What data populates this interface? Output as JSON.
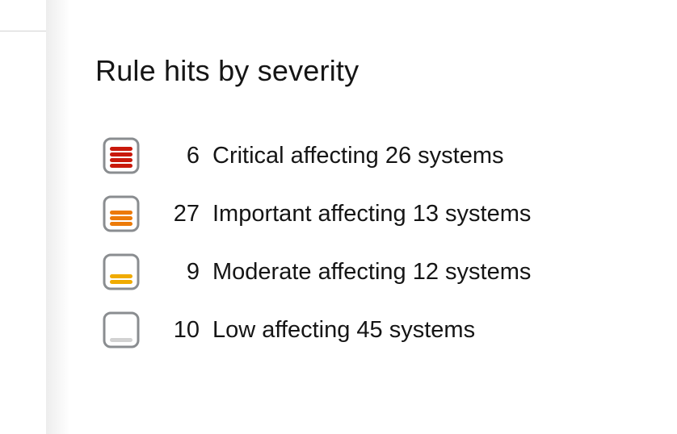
{
  "card": {
    "title": "Rule hits by severity"
  },
  "severity": {
    "items": [
      {
        "icon": "critical-severity-icon",
        "count": "6",
        "label": "Critical affecting 26 systems",
        "bars": 4,
        "color": "#c9190b"
      },
      {
        "icon": "important-severity-icon",
        "count": "27",
        "label": "Important affecting 13 systems",
        "bars": 3,
        "color": "#ec7a08"
      },
      {
        "icon": "moderate-severity-icon",
        "count": "9",
        "label": "Moderate affecting 12 systems",
        "bars": 2,
        "color": "#f0ab00"
      },
      {
        "icon": "low-severity-icon",
        "count": "10",
        "label": "Low affecting 45 systems",
        "bars": 1,
        "color": "#d2d2d2"
      }
    ]
  },
  "colors": {
    "icon_border": "#8a8d90",
    "text": "#151515"
  }
}
